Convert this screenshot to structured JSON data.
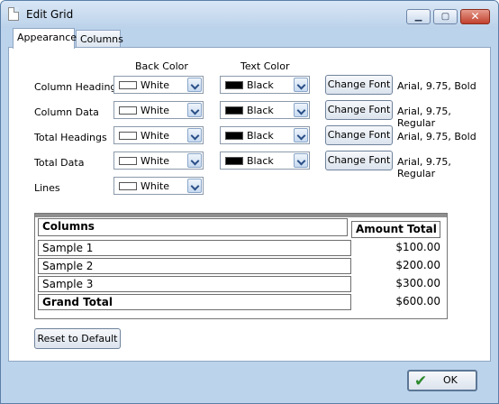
{
  "window": {
    "title": "Edit Grid"
  },
  "tabs": [
    "Appearance",
    "Columns"
  ],
  "headers": {
    "back_color": "Back Color",
    "text_color": "Text Color"
  },
  "rows": [
    {
      "label": "Column Heading",
      "back": "White",
      "text": "Black",
      "button": "Change Font",
      "font": "Arial, 9.75, Bold"
    },
    {
      "label": "Column Data",
      "back": "White",
      "text": "Black",
      "button": "Change Font",
      "font": "Arial, 9.75, Regular"
    },
    {
      "label": "Total Headings",
      "back": "White",
      "text": "Black",
      "button": "Change Font",
      "font": "Arial, 9.75, Bold"
    },
    {
      "label": "Total Data",
      "back": "White",
      "text": "Black",
      "button": "Change Font",
      "font": "Arial, 9.75, Regular"
    },
    {
      "label": "Lines",
      "back": "White"
    }
  ],
  "preview": {
    "columns_header": "Columns",
    "amount_header": "Amount Total",
    "rows": [
      {
        "name": "Sample 1",
        "amount": "$100.00"
      },
      {
        "name": "Sample 2",
        "amount": "$200.00"
      },
      {
        "name": "Sample 3",
        "amount": "$300.00"
      }
    ],
    "total_label": "Grand Total",
    "total_amount": "$600.00"
  },
  "buttons": {
    "reset": "Reset to Default",
    "ok": "OK"
  },
  "colors": {
    "white": "#ffffff",
    "black": "#000000",
    "window_frame": "#bcd3ec"
  },
  "icons": {
    "window": "document-icon",
    "ok": "checkmark-icon"
  }
}
